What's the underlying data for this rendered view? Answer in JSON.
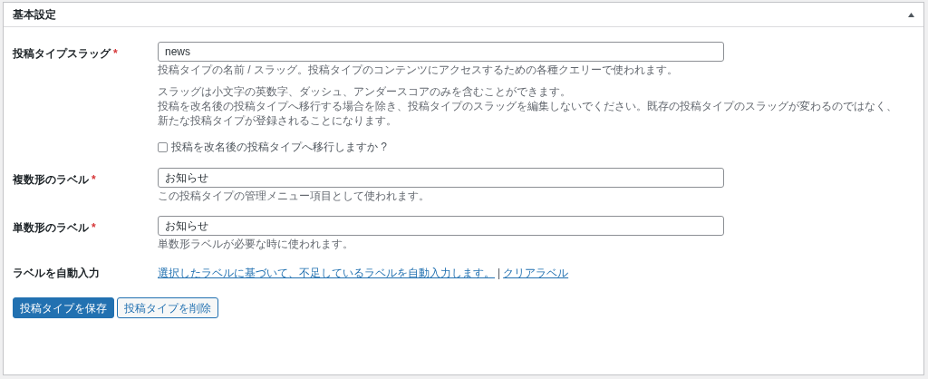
{
  "panel": {
    "title": "基本設定",
    "expanded": true
  },
  "rows": [
    {
      "kind": "text",
      "label": "投稿タイプスラッグ",
      "required": true,
      "required_mark": "*",
      "value": "news",
      "description": "投稿タイプの名前 / スラッグ。投稿タイプのコンテンツにアクセスするための各種クエリーで使われます。",
      "notes": [
        "スラッグは小文字の英数字、ダッシュ、アンダースコアのみを含むことができます。",
        "投稿を改名後の投稿タイプへ移行する場合を除き、投稿タイプのスラッグを編集しないでください。既存の投稿タイプのスラッグが変わるのではなく、新たな投稿タイプが登録されることになります。"
      ],
      "checkbox": {
        "label": "投稿を改名後の投稿タイプへ移行しますか ?",
        "checked": false
      }
    },
    {
      "kind": "text",
      "label": "複数形のラベル",
      "required": true,
      "required_mark": "*",
      "value": "お知らせ",
      "description": "この投稿タイプの管理メニュー項目として使われます。"
    },
    {
      "kind": "text",
      "label": "単数形のラベル",
      "required": true,
      "required_mark": "*",
      "value": "お知らせ",
      "description": "単数形ラベルが必要な時に使われます。"
    },
    {
      "kind": "links",
      "label": "ラベルを自動入力",
      "links": [
        "選択したラベルに基づいて、不足しているラベルを自動入力します。",
        "クリアラベル"
      ],
      "separator": "|"
    }
  ],
  "buttons": [
    {
      "label": "投稿タイプを保存",
      "kind": "primary"
    },
    {
      "label": "投稿タイプを削除",
      "kind": "secondary"
    }
  ]
}
